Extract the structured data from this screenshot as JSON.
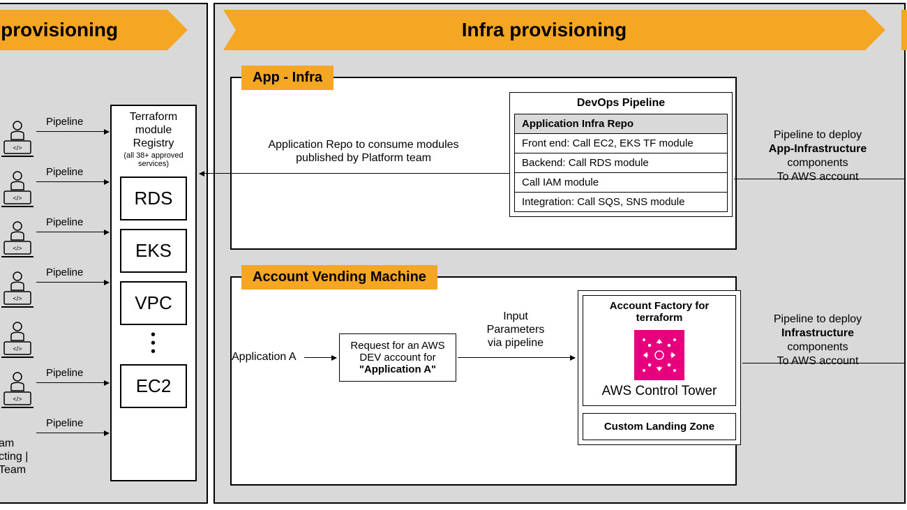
{
  "banners": {
    "left": "le provisioning",
    "right": "Infra provisioning"
  },
  "left_panel": {
    "pipeline_label": "Pipeline",
    "team_label": "am\ncting |\nTeam",
    "registry": {
      "title": "Terraform module Registry",
      "subtitle": "(all 38+ approved services)",
      "modules": [
        "RDS",
        "EKS",
        "VPC",
        "EC2"
      ]
    }
  },
  "app_infra": {
    "badge": "App - Infra",
    "repo_text": "Application Repo to consume modules published by Platform team",
    "devops": {
      "title": "DevOps Pipeline",
      "header": "Application Infra Repo",
      "rows": [
        "Front end: Call EC2, EKS TF module",
        "Backend: Call RDS module",
        "Call IAM module",
        "Integration: Call SQS, SNS module"
      ]
    },
    "deploy_text": "Pipeline to deploy\nApp-Infrastructure\ncomponents\nTo AWS account"
  },
  "avm": {
    "badge": "Account Vending Machine",
    "app_label": "Application A",
    "request_text": "Request for an AWS DEV account for \"Application A\"",
    "input_label": "Input\nParameters\nvia pipeline",
    "account_factory": {
      "title": "Account Factory for terraform",
      "service": "AWS Control Tower",
      "clz": "Custom Landing Zone"
    },
    "deploy_text": "Pipeline to deploy\nInfrastructure\ncomponents\nTo AWS account"
  }
}
